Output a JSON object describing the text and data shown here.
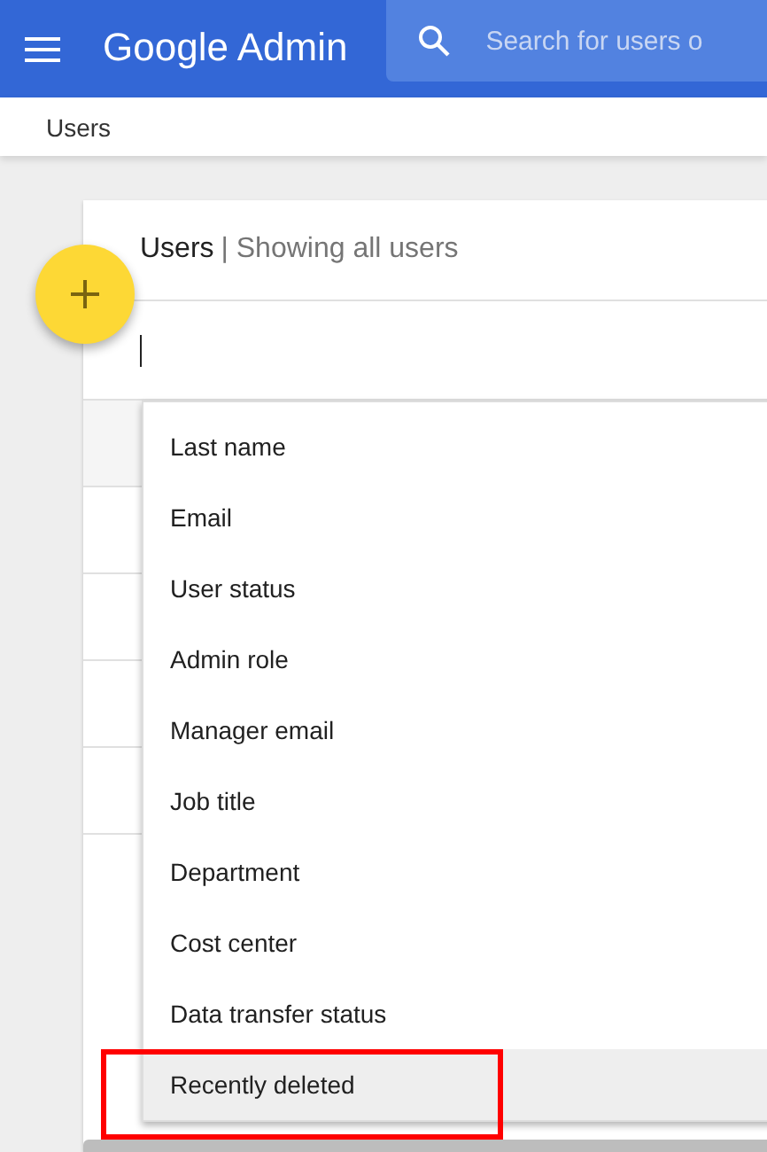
{
  "app_bar": {
    "title": "Google Admin",
    "search": {
      "placeholder": "Search for users o"
    }
  },
  "breadcrumb": "Users",
  "card": {
    "title": "Users",
    "subtitle": "| Showing all users"
  },
  "filter_menu": {
    "items": [
      {
        "label": "Last name",
        "selected": false
      },
      {
        "label": "Email",
        "selected": false
      },
      {
        "label": "User status",
        "selected": false
      },
      {
        "label": "Admin role",
        "selected": false
      },
      {
        "label": "Manager email",
        "selected": false
      },
      {
        "label": "Job title",
        "selected": false
      },
      {
        "label": "Department",
        "selected": false
      },
      {
        "label": "Cost center",
        "selected": false
      },
      {
        "label": "Data transfer status",
        "selected": false
      },
      {
        "label": "Recently deleted",
        "selected": true
      }
    ]
  }
}
